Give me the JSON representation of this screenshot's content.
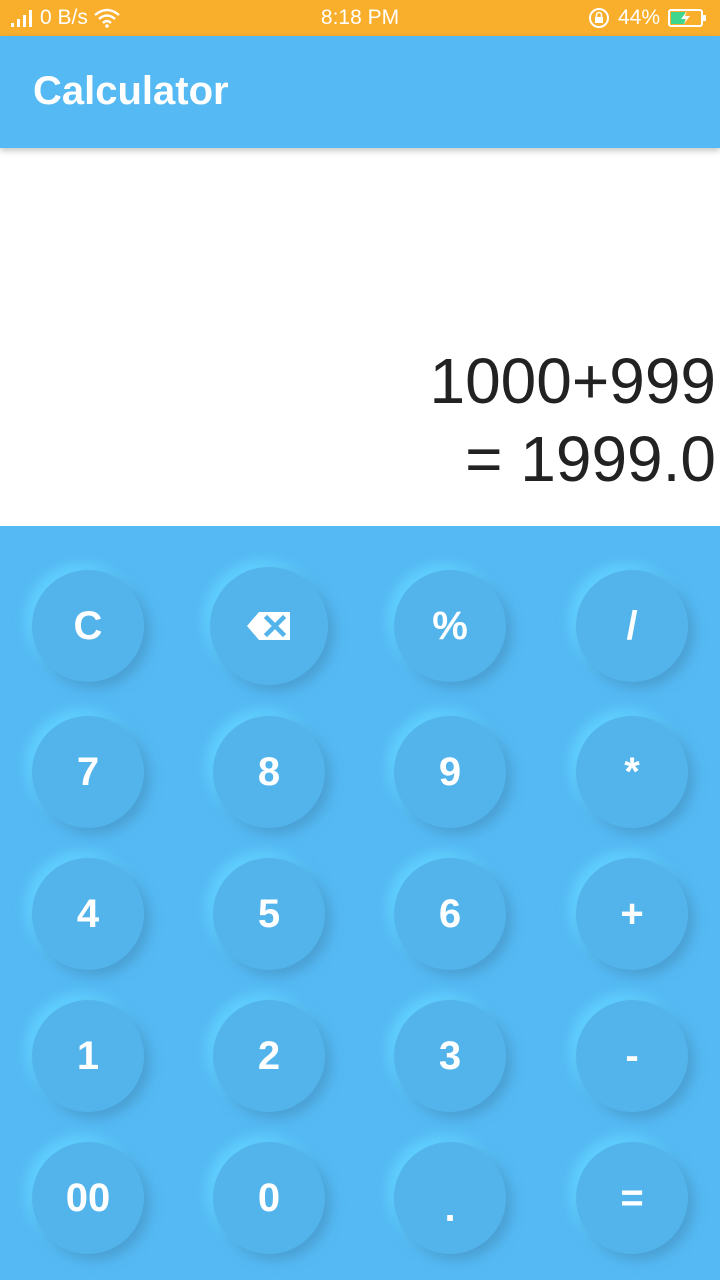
{
  "status_bar": {
    "network_speed": "0 B/s",
    "time": "8:18 PM",
    "battery_percent": "44%",
    "icons": [
      "signal-icon",
      "wifi-icon",
      "rotation-lock-icon",
      "battery-charging-icon"
    ]
  },
  "app_bar": {
    "title": "Calculator"
  },
  "display": {
    "expression": "1000+999",
    "result": "= 1999.0"
  },
  "keypad": {
    "rows": [
      [
        {
          "label": "C"
        },
        {
          "label": "",
          "icon": "backspace-icon"
        },
        {
          "label": "%"
        },
        {
          "label": "/"
        }
      ],
      [
        {
          "label": "7"
        },
        {
          "label": "8"
        },
        {
          "label": "9"
        },
        {
          "label": "*"
        }
      ],
      [
        {
          "label": "4"
        },
        {
          "label": "5"
        },
        {
          "label": "6"
        },
        {
          "label": "+"
        }
      ],
      [
        {
          "label": "1"
        },
        {
          "label": "2"
        },
        {
          "label": "3"
        },
        {
          "label": "-"
        }
      ],
      [
        {
          "label": "00"
        },
        {
          "label": "0"
        },
        {
          "label": "."
        },
        {
          "label": "="
        }
      ]
    ]
  },
  "colors": {
    "status_bar": "#F9AE2C",
    "primary": "#55B9F3",
    "text": "#222222",
    "key_text": "#FFFFFF"
  }
}
